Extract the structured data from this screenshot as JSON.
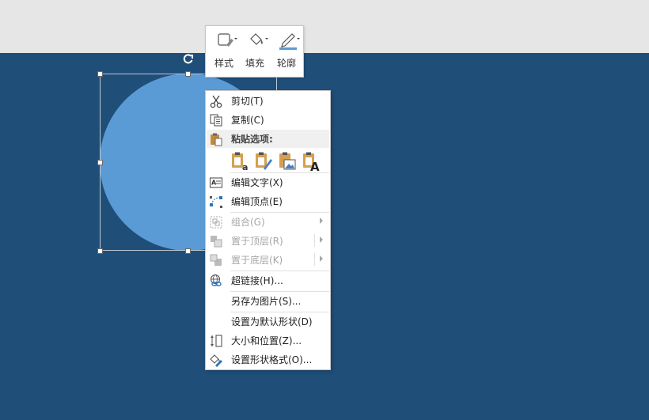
{
  "mini_toolbar": {
    "style_label": "样式",
    "fill_label": "填充",
    "outline_label": "轮廓"
  },
  "context_menu": {
    "cut": "剪切(T)",
    "copy": "复制(C)",
    "paste_options": "粘贴选项:",
    "edit_text": "编辑文字(X)",
    "edit_points": "编辑顶点(E)",
    "group": "组合(G)",
    "bring_to_front": "置于顶层(R)",
    "send_to_back": "置于底层(K)",
    "hyperlink": "超链接(H)...",
    "save_as_picture": "另存为图片(S)...",
    "set_default_shape": "设置为默认形状(D)",
    "size_and_position": "大小和位置(Z)...",
    "format_shape": "设置形状格式(O)..."
  },
  "colors": {
    "slide_background": "#1f4e79",
    "shape_fill": "#5b9bd5",
    "ribbon_background": "#e6e6e6"
  }
}
